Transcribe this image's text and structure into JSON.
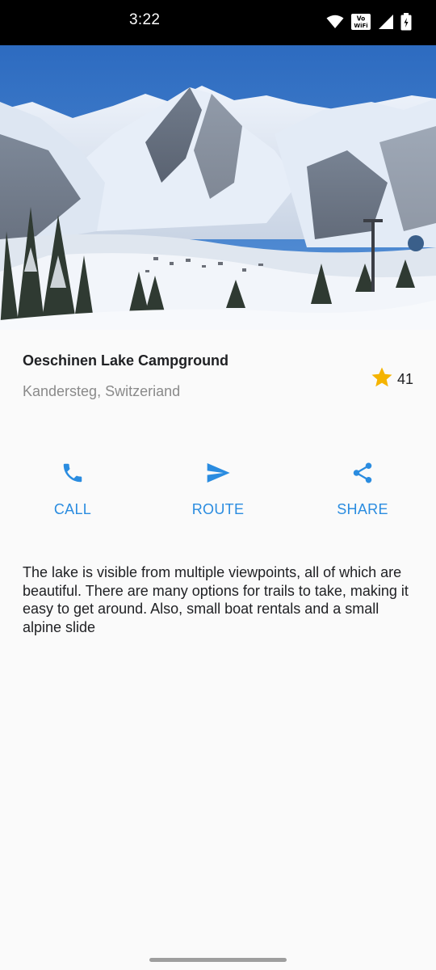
{
  "status_bar": {
    "time": "3:22",
    "icons": [
      "wifi-icon",
      "vowifi-icon",
      "cell-signal-icon",
      "battery-icon"
    ],
    "vowifi_text": "Vo WiFi"
  },
  "hero": {
    "image_description": "snowy-mountain-valley-photo"
  },
  "place": {
    "title": "Oeschinen Lake Campground",
    "location": "Kandersteg, Switzeriand",
    "rating_count": "41"
  },
  "actions": [
    {
      "label": "CALL",
      "icon": "phone-icon"
    },
    {
      "label": "ROUTE",
      "icon": "send-icon"
    },
    {
      "label": "SHARE",
      "icon": "share-icon"
    }
  ],
  "description": "The lake is visible from multiple viewpoints, all of which are beautiful. There are many options for trails to take, making it easy to get around. Also, small boat rentals and a small alpine slide",
  "colors": {
    "accent": "#2a8ce0",
    "star": "#f5b400",
    "background": "#fafafa"
  }
}
